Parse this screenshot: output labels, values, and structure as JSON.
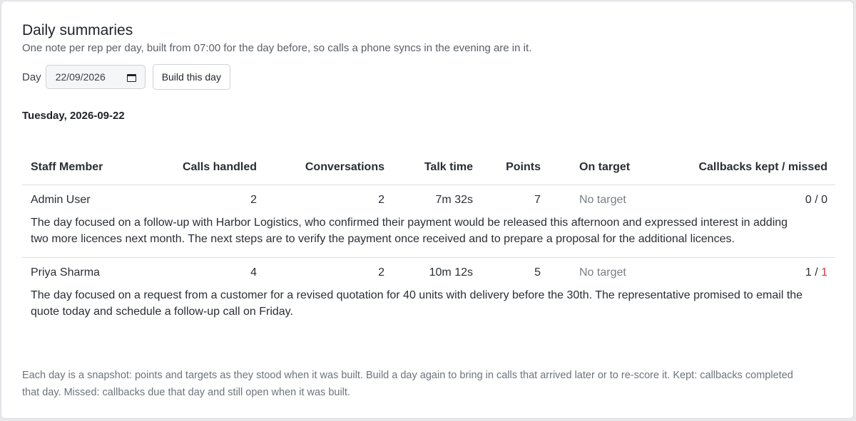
{
  "header": {
    "title": "Daily summaries",
    "subtitle": "One note per rep per day, built from 07:00 for the day before, so calls a phone syncs in the evening are in it."
  },
  "controls": {
    "day_label": "Day",
    "date_value": "22/09/2026",
    "build_button": "Build this day"
  },
  "date_heading": "Tuesday, 2026-09-22",
  "table": {
    "columns": [
      "Staff Member",
      "Calls handled",
      "Conversations",
      "Talk time",
      "Points",
      "On target",
      "Callbacks kept / missed"
    ],
    "rows": [
      {
        "name": "Admin User",
        "calls": "2",
        "conversations": "2",
        "talk_time": "7m 32s",
        "points": "7",
        "on_target": "No target",
        "kept": "0",
        "separator": " / ",
        "missed": "0",
        "summary": "The day focused on a follow-up with Harbor Logistics, who confirmed their payment would be released this afternoon and expressed interest in adding two more licences next month. The next steps are to verify the payment once received and to prepare a proposal for the additional licences."
      },
      {
        "name": "Priya Sharma",
        "calls": "4",
        "conversations": "2",
        "talk_time": "10m 12s",
        "points": "5",
        "on_target": "No target",
        "kept": "1",
        "separator": " / ",
        "missed": "1",
        "summary": "The day focused on a request from a customer for a revised quotation for 40 units with delivery before the 30th. The representative promised to email the quote today and schedule a follow-up call on Friday."
      }
    ]
  },
  "footnote": "Each day is a snapshot: points and targets as they stood when it was built. Build a day again to bring in calls that arrived later or to re-score it. Kept: callbacks completed that day. Missed: callbacks due that day and still open when it was built.",
  "icons": {
    "date_picker": "calendar-icon"
  },
  "colors": {
    "missed_nonzero": "#d23b35",
    "muted_text": "#7a7f86"
  }
}
